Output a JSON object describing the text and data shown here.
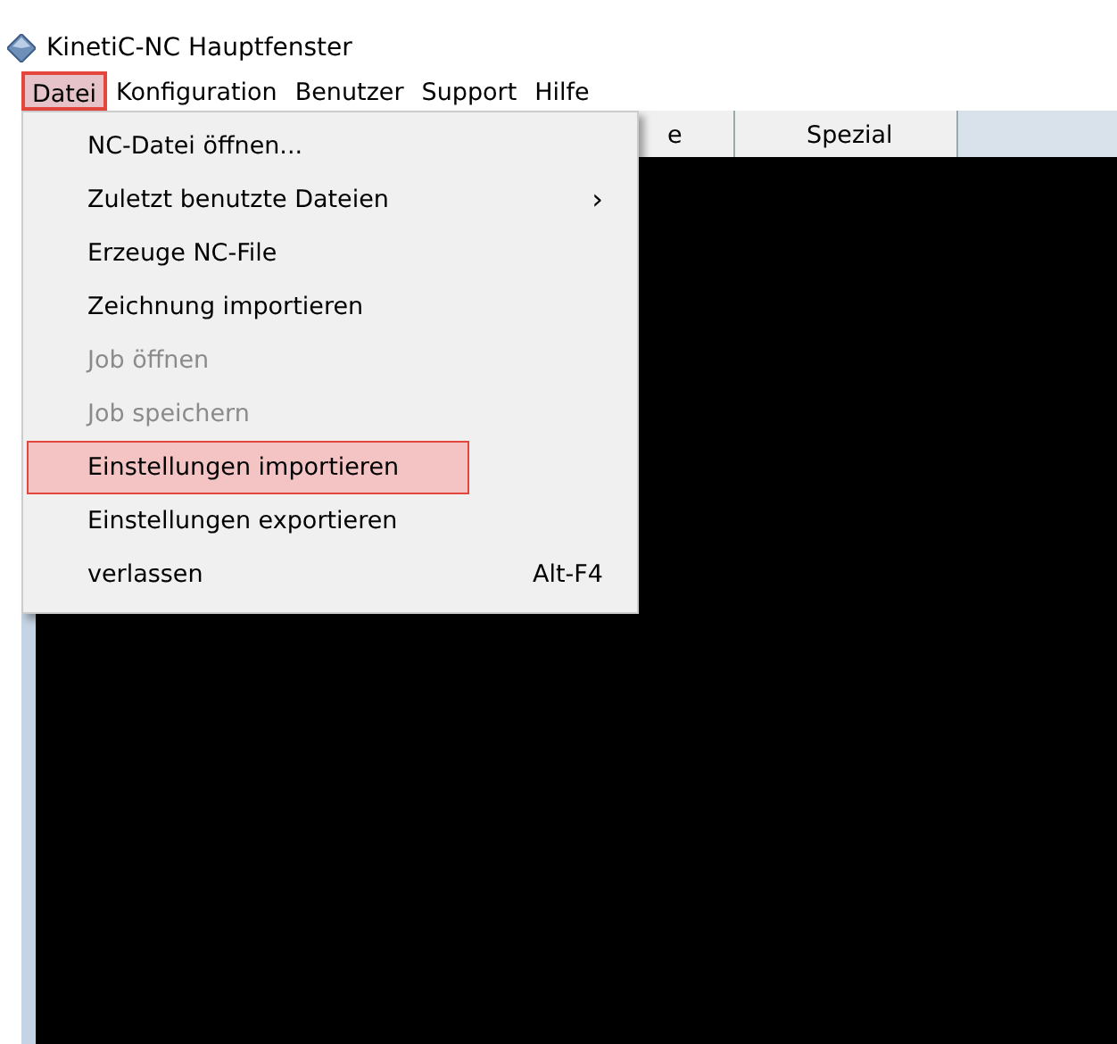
{
  "window": {
    "title": "KinetiC-NC Hauptfenster"
  },
  "menu_bar": [
    {
      "label": "Datei",
      "selected": true,
      "highlighted": true
    },
    {
      "label": "Konfiguration",
      "selected": false,
      "highlighted": false
    },
    {
      "label": "Benutzer",
      "selected": false,
      "highlighted": false
    },
    {
      "label": "Support",
      "selected": false,
      "highlighted": false
    },
    {
      "label": "Hilfe",
      "selected": false,
      "highlighted": false
    }
  ],
  "tabs": [
    {
      "label": "e"
    },
    {
      "label": "Spezial"
    }
  ],
  "dropdown": [
    {
      "label": "NC-Datei öffnen...",
      "disabled": false,
      "highlighted": false
    },
    {
      "label": "Zuletzt benutzte Dateien",
      "disabled": false,
      "highlighted": false,
      "submenu": "›"
    },
    {
      "label": "Erzeuge NC-File",
      "disabled": false,
      "highlighted": false
    },
    {
      "label": "Zeichnung importieren",
      "disabled": false,
      "highlighted": false
    },
    {
      "label": "Job öffnen",
      "disabled": true,
      "highlighted": false
    },
    {
      "label": "Job speichern",
      "disabled": true,
      "highlighted": false
    },
    {
      "label": "Einstellungen importieren",
      "disabled": false,
      "highlighted": true
    },
    {
      "label": "Einstellungen exportieren",
      "disabled": false,
      "highlighted": false
    },
    {
      "label": "verlassen",
      "disabled": false,
      "highlighted": false,
      "shortcut": "Alt-F4"
    }
  ]
}
